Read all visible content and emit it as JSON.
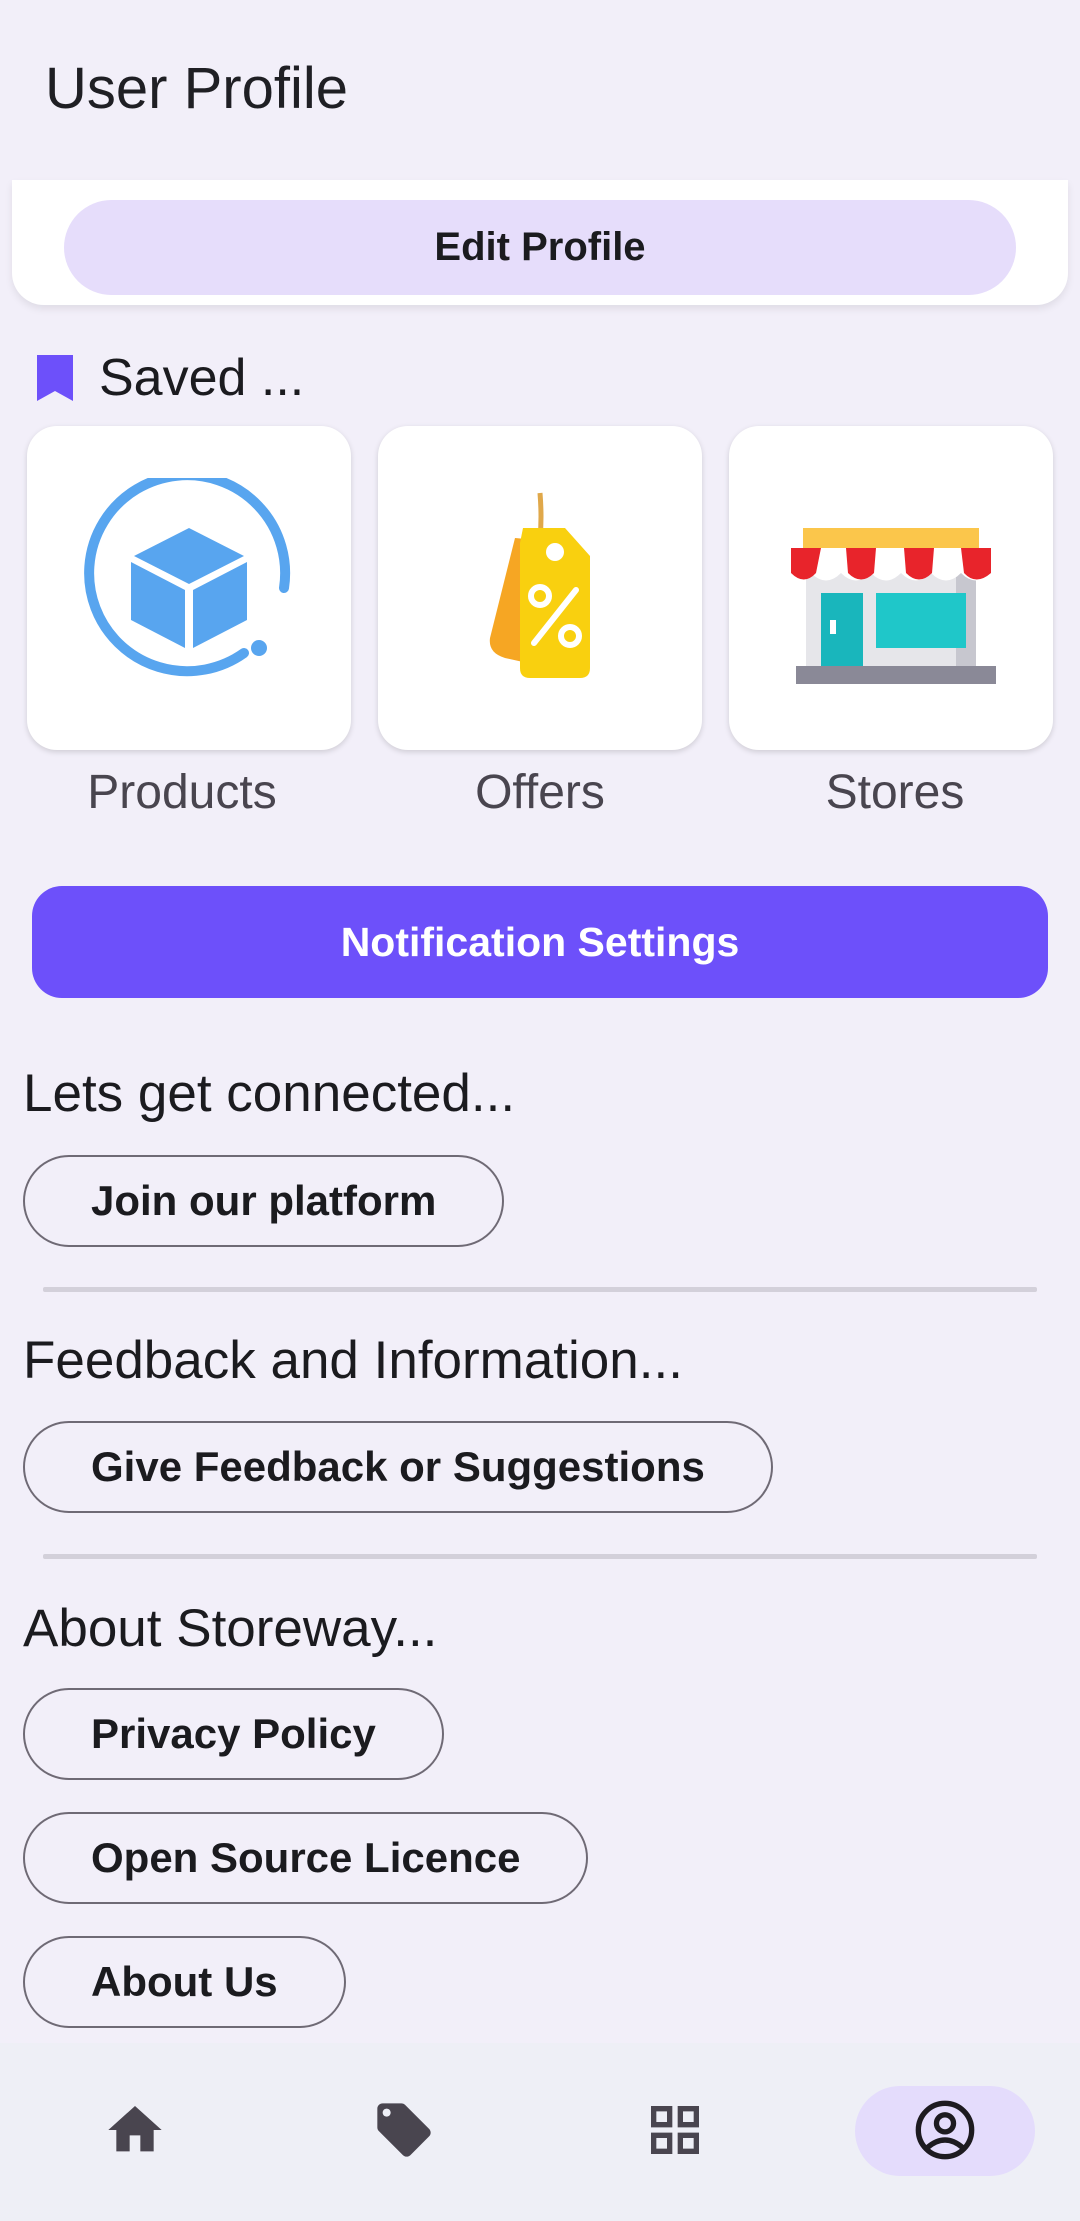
{
  "header": {
    "title": "User Profile"
  },
  "profile": {
    "edit_label": "Edit Profile"
  },
  "saved": {
    "title": "Saved ...",
    "items": [
      {
        "label": "Products",
        "icon": "cube-icon"
      },
      {
        "label": "Offers",
        "icon": "discount-tag-icon"
      },
      {
        "label": "Stores",
        "icon": "storefront-icon"
      }
    ]
  },
  "notifications": {
    "label": "Notification Settings"
  },
  "connect": {
    "title": "Lets get connected...",
    "join_label": "Join our platform"
  },
  "feedback": {
    "title": "Feedback and Information...",
    "feedback_label": "Give Feedback or Suggestions"
  },
  "about": {
    "title": "About Storeway...",
    "privacy_label": "Privacy Policy",
    "licence_label": "Open Source Licence",
    "about_label": "About Us"
  },
  "nav": {
    "items": [
      "home-icon",
      "tag-icon",
      "grid-icon",
      "account-circle-icon"
    ],
    "active": "account-circle-icon"
  },
  "colors": {
    "accent": "#6d50fa",
    "tonal": "#e6ddfb",
    "background": "#f2eff9"
  }
}
